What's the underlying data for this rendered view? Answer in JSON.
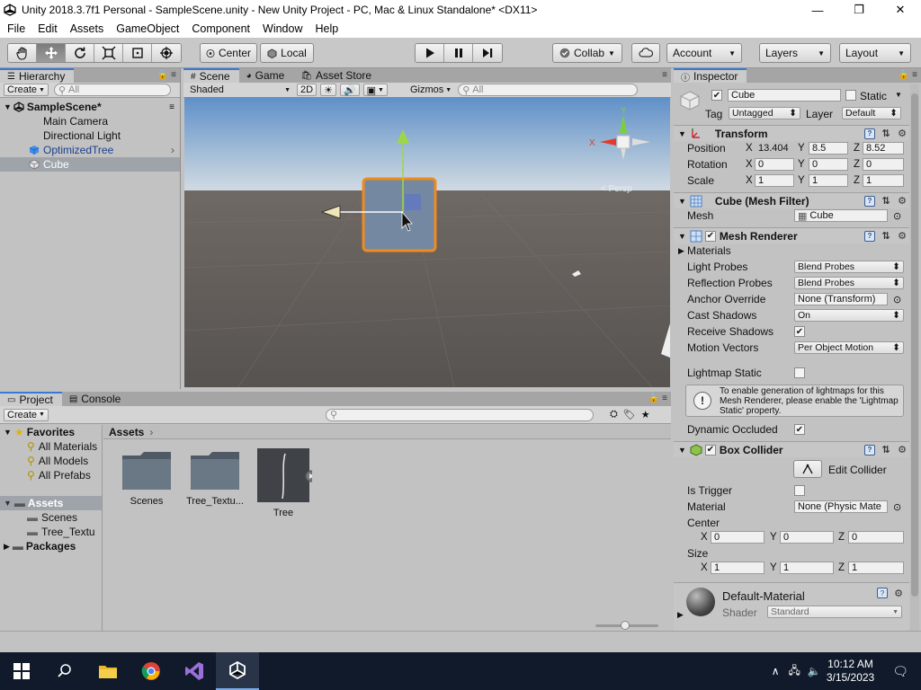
{
  "window": {
    "title": "Unity 2018.3.7f1 Personal - SampleScene.unity - New Unity Project - PC, Mac & Linux Standalone* <DX11>",
    "minimize": "—",
    "maximize": "❐",
    "close": "✕"
  },
  "menu": [
    "File",
    "Edit",
    "Assets",
    "GameObject",
    "Component",
    "Window",
    "Help"
  ],
  "toolbar": {
    "pivot": "Center",
    "space": "Local",
    "collab": "Collab",
    "account": "Account",
    "layers": "Layers",
    "layout": "Layout"
  },
  "hierarchy": {
    "tab": "Hierarchy",
    "create": "Create",
    "search_placeholder": "All",
    "scene": "SampleScene*",
    "items": [
      "Main Camera",
      "Directional Light",
      "OptimizedTree",
      "Cube"
    ]
  },
  "scene": {
    "tabs": [
      "Scene",
      "Game",
      "Asset Store"
    ],
    "shading": "Shaded",
    "mode_2d": "2D",
    "gizmos": "Gizmos",
    "search_placeholder": "All",
    "gizmo_persp": "< Persp"
  },
  "project": {
    "tabs": [
      "Project",
      "Console"
    ],
    "create": "Create",
    "favorites_label": "Favorites",
    "favorites": [
      "All Materials",
      "All Models",
      "All Prefabs"
    ],
    "assets_label": "Assets",
    "asset_folders": [
      "Scenes",
      "Tree_Textu"
    ],
    "packages_label": "Packages",
    "breadcrumb": "Assets",
    "grid_items": [
      "Scenes",
      "Tree_Textu...",
      "Tree"
    ]
  },
  "inspector": {
    "tab": "Inspector",
    "object_name": "Cube",
    "static_label": "Static",
    "tag_label": "Tag",
    "tag_value": "Untagged",
    "layer_label": "Layer",
    "layer_value": "Default",
    "transform": {
      "title": "Transform",
      "position_label": "Position",
      "rotation_label": "Rotation",
      "scale_label": "Scale",
      "position": [
        "13.404",
        "8.5",
        "8.52"
      ],
      "rotation": [
        "0",
        "0",
        "0"
      ],
      "scale": [
        "1",
        "1",
        "1"
      ]
    },
    "mesh_filter": {
      "title": "Cube (Mesh Filter)",
      "mesh_label": "Mesh",
      "mesh_value": "Cube"
    },
    "mesh_renderer": {
      "title": "Mesh Renderer",
      "materials": "Materials",
      "rows": [
        {
          "label": "Light Probes",
          "value": "Blend Probes"
        },
        {
          "label": "Reflection Probes",
          "value": "Blend Probes"
        },
        {
          "label": "Anchor Override",
          "value": "None (Transform)"
        },
        {
          "label": "Cast Shadows",
          "value": "On"
        },
        {
          "label": "Receive Shadows",
          "value": ""
        },
        {
          "label": "Motion Vectors",
          "value": "Per Object Motion"
        }
      ],
      "lightmap_static": "Lightmap Static",
      "info": "To enable generation of lightmaps for this Mesh Renderer, please enable the 'Lightmap Static' property.",
      "dynamic_occluded": "Dynamic Occluded"
    },
    "box_collider": {
      "title": "Box Collider",
      "edit_collider": "Edit Collider",
      "is_trigger": "Is Trigger",
      "material_label": "Material",
      "material_value": "None (Physic Mate",
      "center_label": "Center",
      "center": [
        "0",
        "0",
        "0"
      ],
      "size_label": "Size",
      "size": [
        "1",
        "1",
        "1"
      ]
    },
    "material": {
      "name": "Default-Material",
      "shader_label": "Shader",
      "shader_value": "Standard"
    }
  },
  "axis_labels": {
    "x": "X",
    "y": "Y",
    "z": "Z"
  },
  "taskbar": {
    "time": "10:12 AM",
    "date": "3/15/2023"
  }
}
